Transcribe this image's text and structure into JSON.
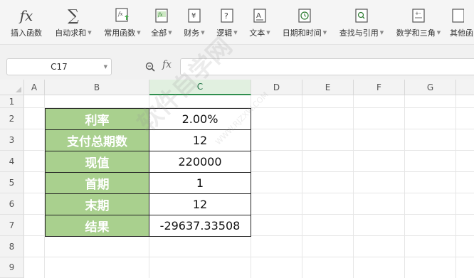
{
  "ribbon": {
    "items": [
      {
        "label": "插入函数",
        "icon": "function-icon",
        "caret": false
      },
      {
        "label": "自动求和",
        "icon": "sum-icon",
        "caret": true
      },
      {
        "label": "常用函数",
        "icon": "common-functions-icon",
        "caret": true
      },
      {
        "label": "全部",
        "icon": "all-functions-icon",
        "caret": true
      },
      {
        "label": "财务",
        "icon": "finance-icon",
        "caret": true
      },
      {
        "label": "逻辑",
        "icon": "logic-icon",
        "caret": true
      },
      {
        "label": "文本",
        "icon": "text-icon",
        "caret": true
      },
      {
        "label": "日期和时间",
        "icon": "datetime-icon",
        "caret": true
      },
      {
        "label": "查找与引用",
        "icon": "lookup-icon",
        "caret": true
      },
      {
        "label": "数学和三角",
        "icon": "math-icon",
        "caret": true
      },
      {
        "label": "其他函",
        "icon": "other-functions-icon",
        "caret": false
      }
    ]
  },
  "formula_bar": {
    "name_box": "C17",
    "fx_label": "fx",
    "formula": ""
  },
  "columns": [
    "A",
    "B",
    "C",
    "D",
    "E",
    "F",
    "G"
  ],
  "selected_column": "C",
  "rows": [
    "1",
    "2",
    "3",
    "4",
    "5",
    "6",
    "7",
    "8",
    "9"
  ],
  "table": [
    {
      "label": "利率",
      "value": "2.00%"
    },
    {
      "label": "支付总期数",
      "value": "12"
    },
    {
      "label": "现值",
      "value": "220000"
    },
    {
      "label": "首期",
      "value": "1"
    },
    {
      "label": "末期",
      "value": "12"
    },
    {
      "label": "结果",
      "value": "-29637.33508"
    }
  ],
  "watermark": {
    "text": "软件自学网",
    "url": "WWW.RJZXW.COM"
  },
  "colors": {
    "label_fill": "#a9d08e",
    "selected_header": "#2f8f4e"
  }
}
